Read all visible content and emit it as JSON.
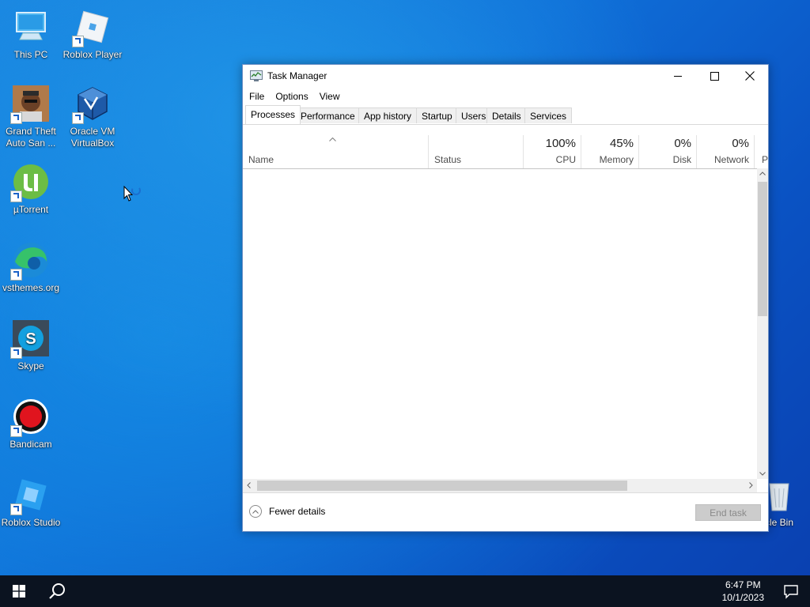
{
  "desktop": {
    "icons": [
      {
        "label": "This PC"
      },
      {
        "label": "Roblox Player"
      },
      {
        "label": "Grand Theft Auto San ..."
      },
      {
        "label": "Oracle VM VirtualBox"
      },
      {
        "label": "µTorrent"
      },
      {
        "label": "vsthemes.org"
      },
      {
        "label": "Skype"
      },
      {
        "label": "Bandicam"
      },
      {
        "label": "Roblox Studio"
      },
      {
        "label": "cle Bin"
      }
    ]
  },
  "window": {
    "title": "Task Manager",
    "menu": [
      "File",
      "Options",
      "View"
    ],
    "tabs": [
      "Processes",
      "Performance",
      "App history",
      "Startup",
      "Users",
      "Details",
      "Services"
    ],
    "active_tab": "Processes",
    "columns": {
      "name": "Name",
      "status": "Status",
      "cpu": {
        "pct": "100%",
        "label": "CPU"
      },
      "memory": {
        "pct": "45%",
        "label": "Memory"
      },
      "disk": {
        "pct": "0%",
        "label": "Disk"
      },
      "network": {
        "pct": "0%",
        "label": "Network"
      },
      "next": "P"
    },
    "footer": {
      "fewer_details": "Fewer details",
      "end_task": "End task"
    }
  },
  "taskbar": {
    "time": "6:47 PM",
    "date": "10/1/2023"
  },
  "colors": {
    "desktop_accent": "#1a84df",
    "taskbar": "#0b1320",
    "window_border": "#6b8ec4"
  }
}
